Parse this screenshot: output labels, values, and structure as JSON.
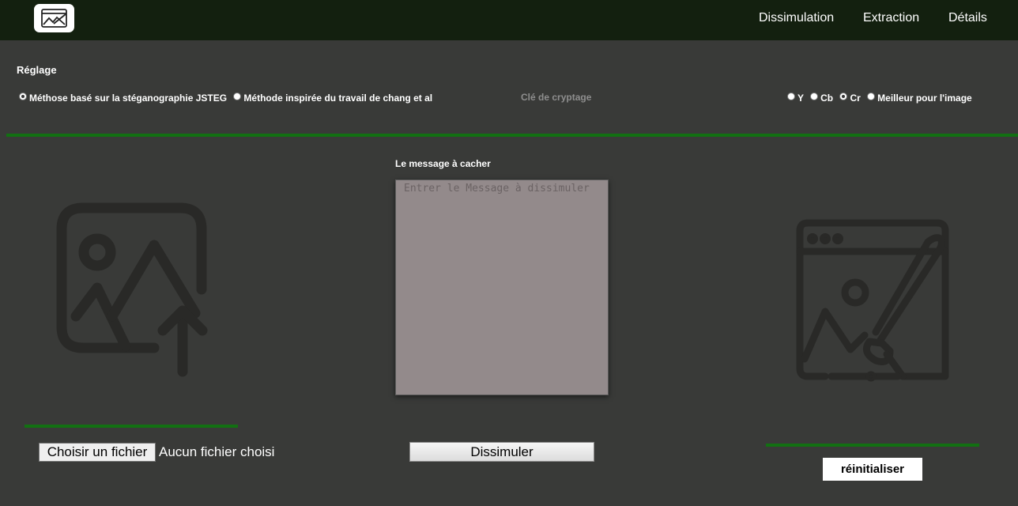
{
  "nav": {
    "logo_icon": "image-with-pen-logo-icon",
    "links": [
      "Dissimulation",
      "Extraction",
      "Détails"
    ]
  },
  "settings": {
    "title": "Réglage",
    "method_jsteg": "Méthose basé sur la stéganographie JSTEG",
    "method_chang": "Méthode inspirée du travail de chang et al",
    "encryption_key_placeholder": "Clé de cryptage",
    "channels": [
      "Y",
      "Cb",
      "Cr",
      "Meilleur pour l'image"
    ]
  },
  "message": {
    "label": "Le message à cacher",
    "placeholder": "Entrer le Message à dissimuler",
    "value": ""
  },
  "upload": {
    "icon": "image-upload-icon",
    "button_label": "Choisir un fichier",
    "status": "Aucun fichier choisi"
  },
  "actions": {
    "hide_label": "Dissimuler",
    "reset_label": "réinitialiser"
  },
  "output": {
    "icon": "image-edit-brush-icon"
  },
  "colors": {
    "background": "#393a38",
    "navbar": "#13200f",
    "accent_rule": "#127012",
    "textarea_bg": "#938a8b",
    "icon": "#292927"
  }
}
